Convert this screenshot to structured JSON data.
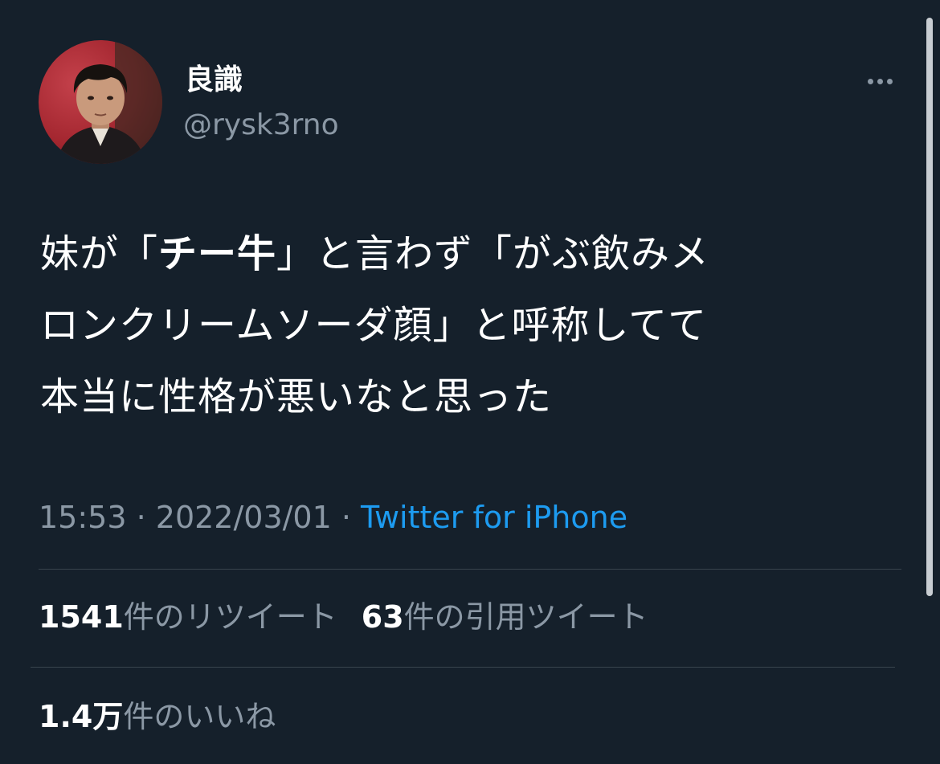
{
  "user": {
    "display_name": "良識",
    "handle": "@rysk3rno",
    "avatar_icon": "profile-photo-child"
  },
  "menu": {
    "icon": "more-horizontal-icon"
  },
  "tweet": {
    "line1_pre": "妹が「",
    "line1_bold": "チー牛",
    "line1_post": "」と言わず「がぶ飲みメ",
    "line2": "ロンクリームソーダ顔」と呼称してて",
    "line3": "本当に性格が悪いなと思った"
  },
  "meta": {
    "time": "15:53",
    "separator1": " · ",
    "date": "2022/03/01",
    "separator2": " · ",
    "source": "Twitter for iPhone"
  },
  "stats": {
    "retweets_count": "1541",
    "retweets_label": "件のリツイート",
    "quotes_count": "63",
    "quotes_label": "件の引用ツイート",
    "likes_count": "1.4万",
    "likes_label": "件のいいね"
  },
  "colors": {
    "background": "#15202b",
    "text": "#ffffff",
    "secondary_text": "#8b98a5",
    "link": "#1d9bf0",
    "divider": "#38444d"
  }
}
